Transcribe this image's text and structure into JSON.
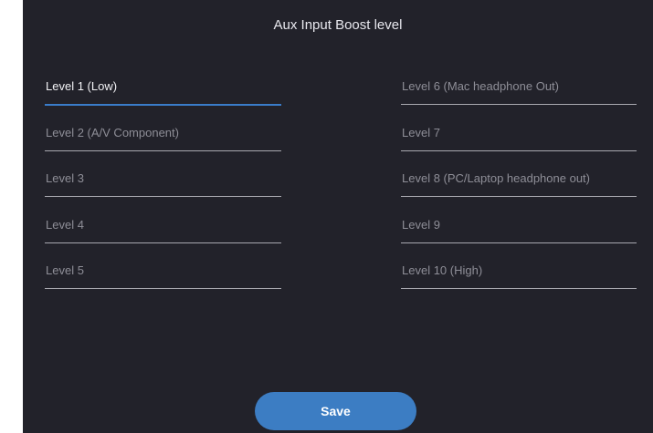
{
  "title": "Aux Input Boost level",
  "levels_left": [
    {
      "label": "Level 1 (Low)",
      "selected": true
    },
    {
      "label": "Level 2 (A/V Component)",
      "selected": false
    },
    {
      "label": "Level 3",
      "selected": false
    },
    {
      "label": "Level 4",
      "selected": false
    },
    {
      "label": "Level 5",
      "selected": false
    }
  ],
  "levels_right": [
    {
      "label": "Level 6 (Mac headphone Out)",
      "selected": false
    },
    {
      "label": "Level 7",
      "selected": false
    },
    {
      "label": "Level 8 (PC/Laptop headphone out)",
      "selected": false
    },
    {
      "label": "Level 9",
      "selected": false
    },
    {
      "label": "Level 10 (High)",
      "selected": false
    }
  ],
  "save_label": "Save",
  "colors": {
    "background": "#22222a",
    "accent": "#3c7dc3",
    "selected_underline": "#3a7cc9",
    "text_selected": "#f2f2f5",
    "text_normal": "#8e8e97"
  }
}
